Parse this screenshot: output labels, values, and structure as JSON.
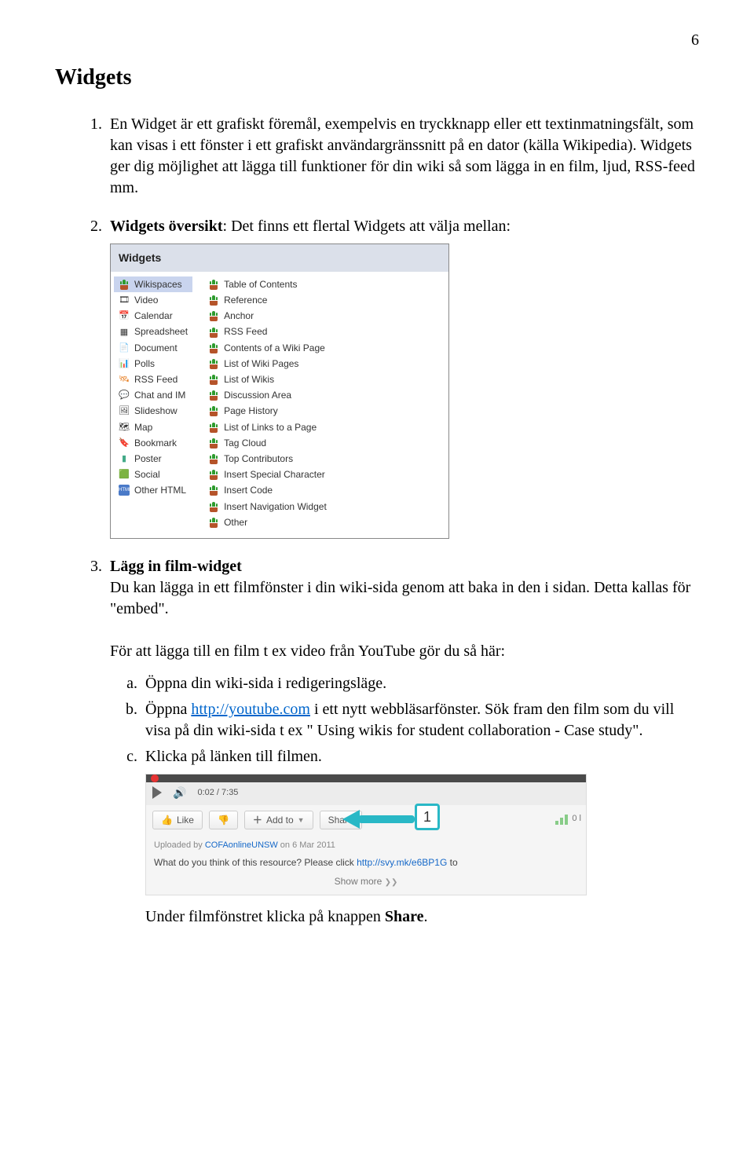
{
  "page_number": "6",
  "heading": "Widgets",
  "items": {
    "i1": {
      "text_a": "En Widget är ett grafiskt föremål, exempelvis en tryckknapp eller ett textinmatningsfält, som kan visas i ett fönster i ett grafiskt användargränssnitt på en dator (källa Wikipedia). Widgets ger dig möjlighet att lägga till funktioner för din wiki så som lägga in en film, ljud, RSS-feed mm."
    },
    "i2": {
      "lead_bold": "Widgets översikt",
      "text": ": Det finns ett flertal Widgets att välja mellan:"
    },
    "i3": {
      "lead_bold": "Lägg in film-widget",
      "text_a": "Du kan lägga in ett filmfönster i din wiki-sida genom att baka in den i sidan. Detta kallas för \"embed\".",
      "text_b": "För att lägga till en film t ex video från YouTube gör du så här:",
      "sub": {
        "a": "Öppna din wiki-sida i redigeringsläge.",
        "b_pre": "Öppna  ",
        "b_link": "http://youtube.com",
        "b_post": " i ett nytt webbläsarfönster. Sök fram den film som du vill visa på din wiki-sida t ex \" Using wikis for student collaboration - Case study\".",
        "c": "Klicka på länken till filmen."
      }
    }
  },
  "widgets_dialog": {
    "title": "Widgets",
    "left": [
      "Wikispaces",
      "Video",
      "Calendar",
      "Spreadsheet",
      "Document",
      "Polls",
      "RSS Feed",
      "Chat and IM",
      "Slideshow",
      "Map",
      "Bookmark",
      "Poster",
      "Social",
      "Other HTML"
    ],
    "left_icons": [
      "pot",
      "🎞",
      "📅",
      "▦",
      "📄",
      "📊",
      "🛰",
      "💬",
      "🖼",
      "🗺",
      "🔖",
      "▮",
      "🟩",
      "HTML"
    ],
    "right": [
      "Table of Contents",
      "Reference",
      "Anchor",
      "RSS Feed",
      "Contents of a Wiki Page",
      "List of Wiki Pages",
      "List of Wikis",
      "Discussion Area",
      "Page History",
      "List of Links to a Page",
      "Tag Cloud",
      "Top Contributors",
      "Insert Special Character",
      "Insert Code",
      "Insert Navigation Widget",
      "Other"
    ]
  },
  "yt": {
    "time": "0:02 / 7:35",
    "like": "Like",
    "addto": "Add to",
    "share": "Share",
    "callout": "1",
    "stat": "0 l",
    "uploaded_pre": "Uploaded by ",
    "uploaded_user": "COFAonlineUNSW",
    "uploaded_post": " on 6 Mar 2011",
    "desc_pre": "What do you think of this resource? Please click ",
    "desc_link": "http://svy.mk/e6BP1G",
    "desc_post": " to",
    "more": "Show more "
  },
  "closing_pre": "Under filmfönstret klicka på knappen ",
  "closing_bold": "Share",
  "closing_post": "."
}
